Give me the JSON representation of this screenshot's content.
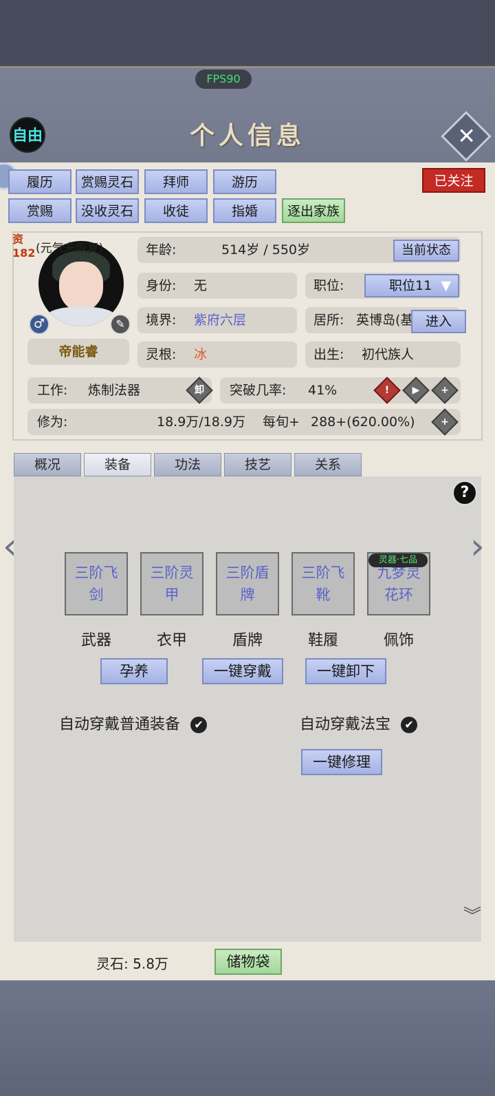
{
  "header": {
    "fps": "FPS90",
    "free_label": "自由",
    "title": "个人信息",
    "close_icon": "close-icon"
  },
  "actions_row1": [
    "履历",
    "赏赐灵石",
    "拜师",
    "游历"
  ],
  "actions_row2": [
    "赏赐",
    "没收灵石",
    "收徒",
    "指婚",
    "逐出家族"
  ],
  "follow_label": "已关注",
  "profile": {
    "aptitude_label": "资",
    "aptitude_value": "182",
    "vitality_note": "(元气未恢复)",
    "name": "帝能睿",
    "age_label": "年龄:",
    "age_value": "514岁 / 550岁",
    "status_button": "当前状态",
    "identity_label": "身份:",
    "identity_value": "无",
    "position_label": "职位:",
    "position_value": "职位11",
    "realm_label": "境界:",
    "realm_value": "紫府六层",
    "residence_label": "居所:",
    "residence_value": "英博岛(基",
    "enter_button": "进入",
    "root_label": "灵根:",
    "root_value": "冰",
    "birth_label": "出生:",
    "birth_value": "初代族人",
    "work_label": "工作:",
    "work_value": "炼制法器",
    "unload_icon_text": "卸",
    "breakthrough_label": "突破几率:",
    "breakthrough_value": "41%",
    "cultivation_label": "修为:",
    "cultivation_value": "18.9万/18.9万",
    "per_round_label": "每旬+",
    "per_round_value": "288+(620.00%)"
  },
  "tabs": [
    "概况",
    "装备",
    "功法",
    "技艺",
    "关系"
  ],
  "active_tab": "装备",
  "equipment": {
    "slots": [
      {
        "item": "三阶飞剑",
        "label": "武器"
      },
      {
        "item": "三阶灵甲",
        "label": "衣甲"
      },
      {
        "item": "三阶盾牌",
        "label": "盾牌"
      },
      {
        "item": "三阶飞靴",
        "label": "鞋履"
      },
      {
        "item": "九梦灵花环",
        "label": "佩饰"
      }
    ],
    "accessory_grade": "灵器·七品",
    "nurture_button": "孕养",
    "wear_all_button": "一键穿戴",
    "remove_all_button": "一键卸下",
    "auto_common_label": "自动穿戴普通装备",
    "auto_treasure_label": "自动穿戴法宝",
    "repair_button": "一键修理"
  },
  "footer": {
    "stone_label": "灵石:",
    "stone_value": "5.8万",
    "bag_button": "储物袋"
  },
  "colors": {
    "accent_blue": "#a5b3e4",
    "green_button": "#a2d89a",
    "follow_red": "#c42a24",
    "realm_purple": "#5a63c9",
    "root_orange": "#e0562a"
  }
}
